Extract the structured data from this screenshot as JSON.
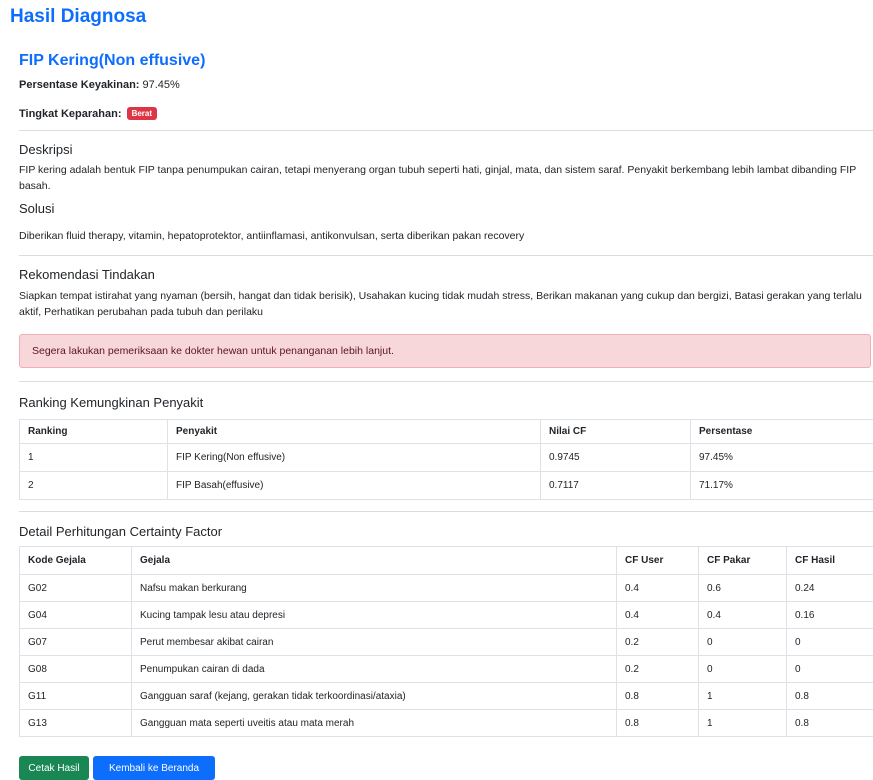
{
  "page": {
    "title": "Hasil Diagnosa"
  },
  "diagnosis": {
    "name": "FIP Kering(Non effusive)",
    "confidence_label": "Persentase Keyakinan:",
    "confidence_value": "97.45%",
    "severity_label": "Tingkat Keparahan:",
    "severity_badge": "Berat",
    "severity_color": "#dc3545"
  },
  "sections": {
    "description": {
      "heading": "Deskripsi",
      "text": "FIP kering adalah bentuk FIP tanpa penumpukan cairan, tetapi menyerang organ tubuh seperti hati, ginjal, mata, dan sistem saraf. Penyakit berkembang lebih lambat dibanding FIP basah."
    },
    "solution": {
      "heading": "Solusi",
      "text": "Diberikan fluid therapy, vitamin, hepatoprotektor, antiinflamasi, antikonvulsan, serta diberikan pakan recovery"
    },
    "recommendation": {
      "heading": "Rekomendasi Tindakan",
      "text": "Siapkan tempat istirahat yang nyaman (bersih, hangat dan tidak berisik), Usahakan kucing tidak mudah stress, Berikan makanan yang cukup dan bergizi, Batasi gerakan yang terlalu aktif, Perhatikan perubahan pada tubuh dan perilaku"
    }
  },
  "alert": {
    "text": "Segera lakukan pemeriksaan ke dokter hewan untuk penanganan lebih lanjut."
  },
  "ranking": {
    "heading": "Ranking Kemungkinan Penyakit",
    "headers": [
      "Ranking",
      "Penyakit",
      "Nilai CF",
      "Persentase"
    ],
    "rows": [
      [
        "1",
        "FIP Kering(Non effusive)",
        "0.9745",
        "97.45%"
      ],
      [
        "2",
        "FIP Basah(effusive)",
        "0.7117",
        "71.17%"
      ]
    ]
  },
  "cf_detail": {
    "heading": "Detail Perhitungan Certainty Factor",
    "headers": [
      "Kode Gejala",
      "Gejala",
      "CF User",
      "CF Pakar",
      "CF Hasil"
    ],
    "rows": [
      [
        "G02",
        "Nafsu makan berkurang",
        "0.4",
        "0.6",
        "0.24"
      ],
      [
        "G04",
        "Kucing tampak lesu atau depresi",
        "0.4",
        "0.4",
        "0.16"
      ],
      [
        "G07",
        "Perut membesar akibat cairan",
        "0.2",
        "0",
        "0"
      ],
      [
        "G08",
        "Penumpukan cairan di dada",
        "0.2",
        "0",
        "0"
      ],
      [
        "G11",
        "Gangguan saraf (kejang, gerakan tidak terkoordinasi/ataxia)",
        "0.8",
        "1",
        "0.8"
      ],
      [
        "G13",
        "Gangguan mata seperti uveitis atau mata merah",
        "0.8",
        "1",
        "0.8"
      ]
    ]
  },
  "buttons": {
    "print": "Cetak Hasil",
    "back": "Kembali ke Beranda"
  },
  "colors": {
    "primary": "#0d6efd",
    "success": "#198754",
    "danger": "#dc3545",
    "alert_bg": "#f8d7da"
  }
}
